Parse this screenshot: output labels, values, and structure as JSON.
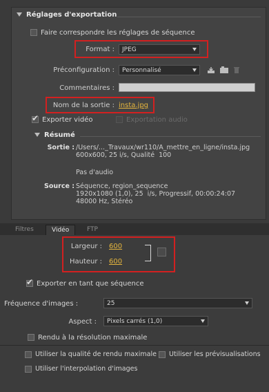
{
  "export_settings": {
    "header": "Réglages d'exportation",
    "match_sequence_label": "Faire correspondre les réglages de séquence",
    "format_label": "Format :",
    "format_value": "JPEG",
    "preset_label": "Préconfiguration :",
    "preset_value": "Personnalisé",
    "comments_label": "Commentaires :",
    "comments_value": "",
    "output_name_label": "Nom de la sortie :",
    "output_name_value": "insta.jpg",
    "export_video_label": "Exporter vidéo",
    "export_audio_label": "Exportation audio"
  },
  "summary": {
    "header": "Résumé",
    "sortie_label": "Sortie :",
    "sortie_line1": "/Users/..._Travaux/wr110/A_mettre_en_ligne/insta.jpg",
    "sortie_line2": "600x600, 25 i/s, Qualité  100",
    "sortie_line3": "Pas d'audio",
    "source_label": "Source :",
    "source_line1": "Séquence, region_sequence",
    "source_line2": "1920x1080 (1,0), 25  i/s, Progressif, 00:00:24:07",
    "source_line3": "48000 Hz, Stéréo"
  },
  "tabs": {
    "filtres": "Filtres",
    "video": "Vidéo",
    "ftp": "FTP"
  },
  "video_panel": {
    "width_label": "Largeur :",
    "width_value": "600",
    "height_label": "Hauteur :",
    "height_value": "600",
    "export_sequence_label": "Exporter en tant que séquence",
    "framerate_label": "Fréquence d'images :",
    "framerate_value": "25",
    "aspect_label": "Aspect :",
    "aspect_value": "Pixels carrés (1,0)",
    "max_res_label": "Rendu à la résolution maximale"
  },
  "bottom_options": {
    "max_quality_label": "Utiliser la qualité de rendu maximale",
    "previews_label": "Utiliser les prévisualisations",
    "interpolation_label": "Utiliser l'interpolation d'images"
  },
  "colors": {
    "highlight_box": "#d32020",
    "link": "#e5b53e"
  }
}
